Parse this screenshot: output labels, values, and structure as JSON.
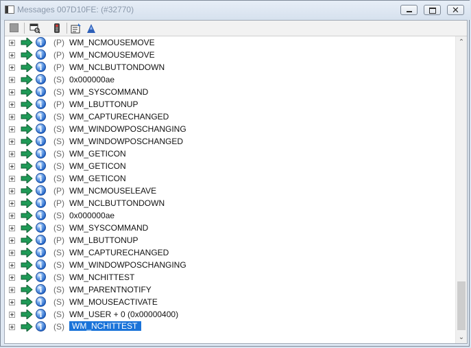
{
  "window": {
    "title": "Messages 007D10FE: (#32770)"
  },
  "titlebar_buttons": {
    "minimize": "minimize",
    "maximize": "maximize",
    "close": "✕"
  },
  "toolbar": {
    "icons": [
      "stop-icon",
      "find-window-icon",
      "traffic-light-icon",
      "properties-icon",
      "highlight-icon"
    ]
  },
  "messages": [
    {
      "type": "(P)",
      "name": "WM_NCMOUSEMOVE"
    },
    {
      "type": "(P)",
      "name": "WM_NCMOUSEMOVE"
    },
    {
      "type": "(P)",
      "name": "WM_NCLBUTTONDOWN"
    },
    {
      "type": "(S)",
      "name": "0x000000ae"
    },
    {
      "type": "(S)",
      "name": "WM_SYSCOMMAND"
    },
    {
      "type": "(P)",
      "name": "WM_LBUTTONUP"
    },
    {
      "type": "(S)",
      "name": "WM_CAPTURECHANGED"
    },
    {
      "type": "(S)",
      "name": "WM_WINDOWPOSCHANGING"
    },
    {
      "type": "(S)",
      "name": "WM_WINDOWPOSCHANGED"
    },
    {
      "type": "(S)",
      "name": "WM_GETICON"
    },
    {
      "type": "(S)",
      "name": "WM_GETICON"
    },
    {
      "type": "(S)",
      "name": "WM_GETICON"
    },
    {
      "type": "(P)",
      "name": "WM_NCMOUSELEAVE"
    },
    {
      "type": "(P)",
      "name": "WM_NCLBUTTONDOWN"
    },
    {
      "type": "(S)",
      "name": "0x000000ae"
    },
    {
      "type": "(S)",
      "name": "WM_SYSCOMMAND"
    },
    {
      "type": "(P)",
      "name": "WM_LBUTTONUP"
    },
    {
      "type": "(S)",
      "name": "WM_CAPTURECHANGED"
    },
    {
      "type": "(S)",
      "name": "WM_WINDOWPOSCHANGING"
    },
    {
      "type": "(S)",
      "name": "WM_NCHITTEST"
    },
    {
      "type": "(S)",
      "name": "WM_PARENTNOTIFY"
    },
    {
      "type": "(S)",
      "name": "WM_MOUSEACTIVATE"
    },
    {
      "type": "(S)",
      "name": "WM_USER + 0 (0x00000400)"
    },
    {
      "type": "(S)",
      "name": "WM_NCHITTEST",
      "selected": true
    }
  ],
  "scrollbar": {
    "up": "⌃",
    "down": "⌄"
  },
  "colors": {
    "selection": "#1a73d9",
    "arrow": "#1f9a57"
  }
}
